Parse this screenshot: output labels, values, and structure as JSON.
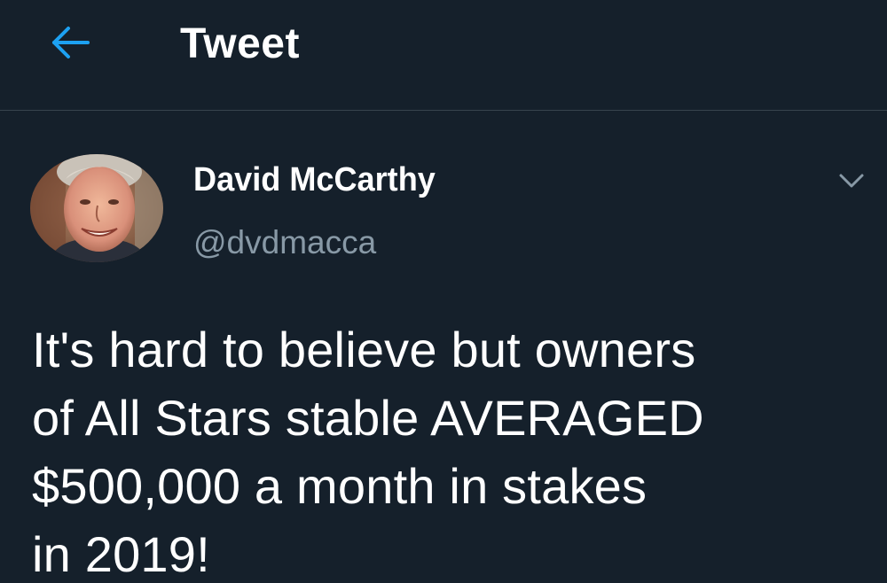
{
  "header": {
    "back_icon": "arrow-left-icon",
    "title": "Tweet"
  },
  "tweet": {
    "author": {
      "display_name": "David McCarthy",
      "handle": "@dvdmacca",
      "avatar": "profile-photo"
    },
    "more_icon": "chevron-down-icon",
    "text": "It's hard to believe but owners\nof All Stars stable AVERAGED\n$500,000 a month in stakes\nin 2019!"
  },
  "colors": {
    "background": "#15202b",
    "accent": "#1da1f2",
    "divider": "#38444d",
    "secondary_text": "#8899a6"
  }
}
